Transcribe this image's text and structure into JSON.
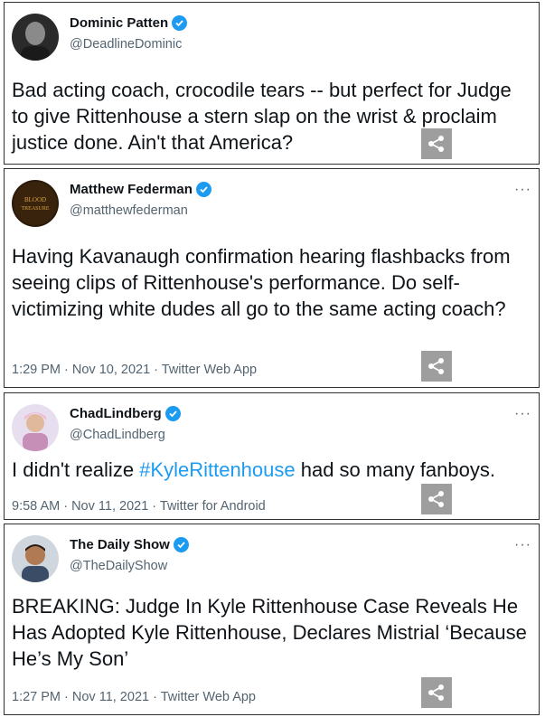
{
  "tweets": [
    {
      "name": "Dominic Patten",
      "handle": "@DeadlineDominic",
      "text": "Bad acting coach, crocodile tears -- but perfect for Judge to give Rittenhouse a stern slap on the wrist & proclaim justice done. Ain't that America?",
      "meta": "",
      "show_more": false
    },
    {
      "name": "Matthew Federman",
      "handle": "@matthewfederman",
      "avatar_text": "BLOOD TREASURE",
      "text": "Having Kavanaugh confirmation hearing flashbacks from seeing clips of Rittenhouse's performance. Do self-victimizing white dudes all go to the same acting coach?",
      "meta": "1:29 PM · Nov 10, 2021 · Twitter Web App",
      "more": "···"
    },
    {
      "name": "ChadLindberg",
      "handle": "@ChadLindberg",
      "text_before": "I didn't realize ",
      "hashtag": "#KyleRittenhouse",
      "text_after": " had so many fanboys.",
      "meta": "9:58 AM · Nov 11, 2021 · Twitter for Android",
      "more": "···"
    },
    {
      "name": "The Daily Show",
      "handle": "@TheDailyShow",
      "text": "BREAKING: Judge In Kyle Rittenhouse Case Reveals He Has Adopted Kyle Rittenhouse, Declares Mistrial ‘Because He’s My Son’",
      "meta": "1:27 PM · Nov 11, 2021 · Twitter Web App",
      "more": "···"
    }
  ],
  "colors": {
    "verified": "#1d9bf0",
    "hashtag": "#1d9bf0",
    "secondary_text": "#536471",
    "share_button": "#9e9e9e"
  },
  "icons": [
    "verified-badge-icon",
    "share-icon",
    "more-options-icon"
  ]
}
